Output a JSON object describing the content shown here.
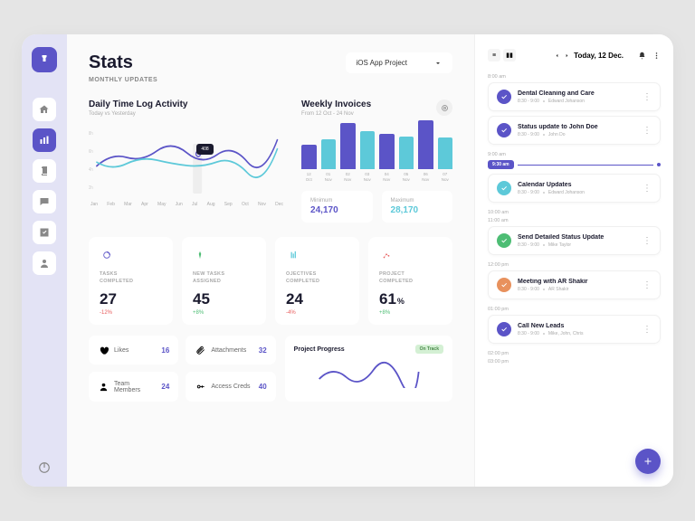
{
  "header": {
    "title": "Stats",
    "subtitle": "MONTHLY UPDATES",
    "project": "iOS App Project"
  },
  "daily_chart": {
    "title": "Daily Time Log Activity",
    "subtitle": "Today vs Yesterday",
    "months": [
      "Jan",
      "Feb",
      "Mar",
      "Apr",
      "May",
      "Jun",
      "Jul",
      "Aug",
      "Sep",
      "Oct",
      "Nov",
      "Dec"
    ],
    "tooltip": "408"
  },
  "weekly_chart": {
    "title": "Weekly Invoices",
    "subtitle": "From 12 Oct - 24 Nov",
    "bars": [
      {
        "label": "12 Oct",
        "value": 45,
        "color": "#5b54c7"
      },
      {
        "label": "01 Nov",
        "value": 55,
        "color": "#5dc9d9"
      },
      {
        "label": "02 Nov",
        "value": 85,
        "color": "#5b54c7"
      },
      {
        "label": "03 Nov",
        "value": 70,
        "color": "#5dc9d9"
      },
      {
        "label": "04 Nov",
        "value": 65,
        "color": "#5b54c7"
      },
      {
        "label": "05 Nov",
        "value": 60,
        "color": "#5dc9d9"
      },
      {
        "label": "06 Nov",
        "value": 90,
        "color": "#5b54c7"
      },
      {
        "label": "07 Nov",
        "value": 58,
        "color": "#5dc9d9"
      }
    ],
    "min_label": "Minimum",
    "min_value": "24,170",
    "max_label": "Maximum",
    "max_value": "28,170"
  },
  "stats": [
    {
      "label": "TASKS\nCOMPLETED",
      "value": "27",
      "change": "-12%",
      "dir": "neg",
      "icon_color": "#5b54c7"
    },
    {
      "label": "NEW TASKS\nASSIGNED",
      "value": "45",
      "change": "+8%",
      "dir": "pos",
      "icon_color": "#4dbd74"
    },
    {
      "label": "OJECTIVES\nCOMPLETED",
      "value": "24",
      "change": "-4%",
      "dir": "neg",
      "icon_color": "#5dc9d9"
    },
    {
      "label": "PROJECT\nCOMPLETED",
      "value": "61",
      "pct": "%",
      "change": "+8%",
      "dir": "pos",
      "icon_color": "#e85d5d"
    }
  ],
  "info": [
    {
      "label": "Likes",
      "value": "16"
    },
    {
      "label": "Attachments",
      "value": "32"
    },
    {
      "label": "Team Members",
      "value": "24"
    },
    {
      "label": "Access Creds",
      "value": "40"
    }
  ],
  "progress": {
    "title": "Project Progress",
    "badge": "On Track"
  },
  "schedule": {
    "date": "Today, 12 Dec.",
    "now": "9:30 am",
    "hours": [
      "8:00 am",
      "9:00 am",
      "10:00 am",
      "11:00 am",
      "12:00 pm",
      "01:00 pm",
      "02:00 pm",
      "03:00 pm"
    ],
    "events": [
      {
        "slot": 0,
        "title": "Dental Cleaning and Care",
        "time": "8:30 - 9:00",
        "person": "Edward Johanson",
        "color": "#5b54c7"
      },
      {
        "slot": 0,
        "title": "Status update to John Doe",
        "time": "8:30 - 9:00",
        "person": "John Do",
        "color": "#5b54c7"
      },
      {
        "slot": 1,
        "title": "Calendar Updates",
        "time": "8:30 - 9:00",
        "person": "Edward Johanson",
        "color": "#5dc9d9"
      },
      {
        "slot": 3,
        "title": "Send Detailed Status Update",
        "time": "8:30 - 9:00",
        "person": "Mike Taylor",
        "color": "#4dbd74"
      },
      {
        "slot": 4,
        "title": "Meeting with AR Shakir",
        "time": "8:30 - 9:00",
        "person": "AR Shakir",
        "color": "#e8915d"
      },
      {
        "slot": 5,
        "title": "Call New Leads",
        "time": "8:30 - 9:00",
        "person": "Mike, John, Chris",
        "color": "#5b54c7"
      }
    ]
  },
  "chart_data": {
    "daily_time_log": {
      "type": "line",
      "title": "Daily Time Log Activity",
      "xlabel": "",
      "ylabel": "",
      "categories": [
        "Jan",
        "Feb",
        "Mar",
        "Apr",
        "May",
        "Jun",
        "Jul",
        "Aug",
        "Sep",
        "Oct",
        "Nov",
        "Dec"
      ],
      "y_ticks": [
        "2h",
        "4h",
        "6h",
        "8h"
      ],
      "series": [
        {
          "name": "Today",
          "values": [
            4.5,
            5.2,
            5.8,
            6.0,
            5.5,
            5.8,
            6.2,
            5.9,
            5.4,
            5.0,
            4.8,
            6.5
          ]
        },
        {
          "name": "Yesterday",
          "values": [
            5.0,
            4.2,
            4.8,
            5.2,
            5.0,
            4.6,
            4.9,
            5.3,
            4.7,
            4.2,
            4.0,
            5.8
          ]
        }
      ]
    },
    "weekly_invoices": {
      "type": "bar",
      "title": "Weekly Invoices",
      "categories": [
        "12 Oct",
        "01 Nov",
        "02 Nov",
        "03 Nov",
        "04 Nov",
        "05 Nov",
        "06 Nov",
        "07 Nov"
      ],
      "values": [
        45,
        55,
        85,
        70,
        65,
        60,
        90,
        58
      ]
    },
    "project_progress": {
      "type": "line",
      "title": "Project Progress",
      "values": [
        40,
        55,
        30,
        65,
        45,
        70,
        50
      ]
    }
  }
}
